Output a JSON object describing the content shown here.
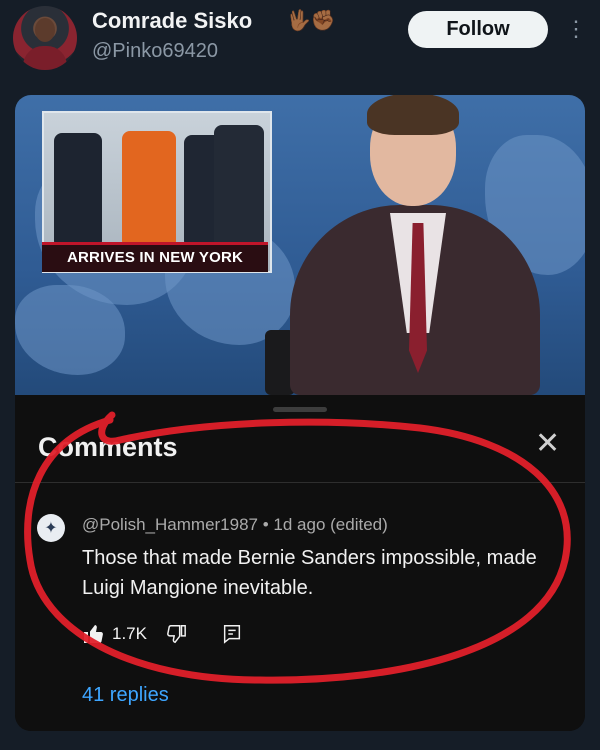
{
  "post": {
    "display_name": "Comrade Sisko",
    "name_emojis": "🖖🏾✊🏾",
    "handle": "@Pinko69420",
    "follow_label": "Follow",
    "more_icon": "more-vertical-icon"
  },
  "video": {
    "inset_caption": "ARRIVES IN NEW YORK"
  },
  "comments_panel": {
    "title": "Comments",
    "close_icon": "close-icon",
    "comment": {
      "meta": "@Polish_Hammer1987 • 1d ago (edited)",
      "text": "Those that made Bernie Sanders impossible, made Luigi Mangione inevitable.",
      "likes": "1.7K"
    },
    "replies_label": "41 replies",
    "link_color": "#3ea6ff"
  },
  "annotation_color": "#e0202a"
}
